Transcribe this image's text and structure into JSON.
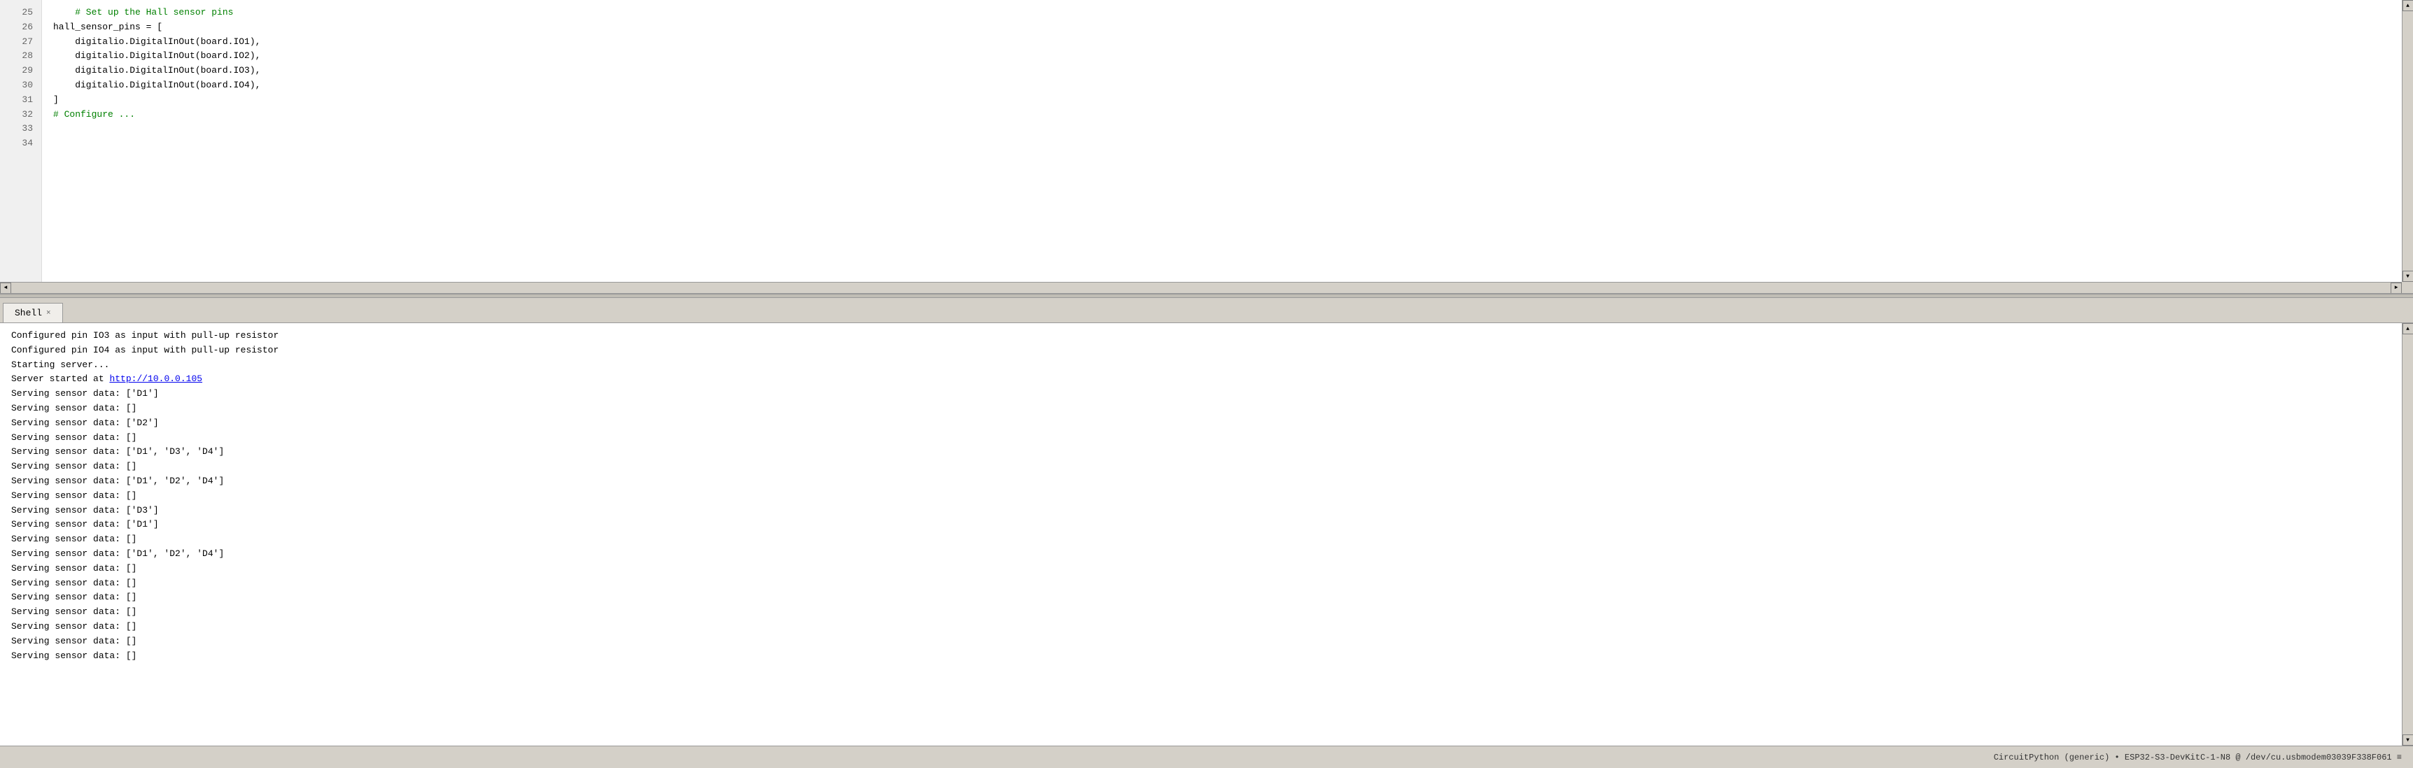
{
  "code_editor": {
    "lines": [
      {
        "num": "25",
        "content": "",
        "type": "normal"
      },
      {
        "num": "26",
        "content": "    # Set up the Hall sensor pins",
        "type": "comment"
      },
      {
        "num": "27",
        "content": "hall_sensor_pins = [",
        "type": "normal"
      },
      {
        "num": "28",
        "content": "    digitalio.DigitalInOut(board.IO1),",
        "type": "normal"
      },
      {
        "num": "29",
        "content": "    digitalio.DigitalInOut(board.IO2),",
        "type": "normal"
      },
      {
        "num": "30",
        "content": "    digitalio.DigitalInOut(board.IO3),",
        "type": "normal"
      },
      {
        "num": "31",
        "content": "    digitalio.DigitalInOut(board.IO4),",
        "type": "normal"
      },
      {
        "num": "32",
        "content": "]",
        "type": "normal"
      },
      {
        "num": "33",
        "content": "",
        "type": "normal"
      },
      {
        "num": "34",
        "content": "# Configure ...",
        "type": "comment"
      }
    ]
  },
  "shell": {
    "tab_label": "Shell",
    "tab_close": "×",
    "output_lines": [
      "Configured pin IO3 as input with pull-up resistor",
      "Configured pin IO4 as input with pull-up resistor",
      "Starting server...",
      "Server started at http://10.0.0.105",
      "Serving sensor data: ['D1']",
      "Serving sensor data: []",
      "Serving sensor data: ['D2']",
      "Serving sensor data: []",
      "Serving sensor data: ['D1', 'D3', 'D4']",
      "Serving sensor data: []",
      "Serving sensor data: ['D1', 'D2', 'D4']",
      "Serving sensor data: []",
      "Serving sensor data: ['D3']",
      "Serving sensor data: ['D1']",
      "Serving sensor data: []",
      "Serving sensor data: ['D1', 'D2', 'D4']",
      "Serving sensor data: []",
      "Serving sensor data: []",
      "Serving sensor data: []",
      "Serving sensor data: []",
      "Serving sensor data: []",
      "Serving sensor data: []",
      "Serving sensor data: []"
    ],
    "server_url": "http://10.0.0.105"
  },
  "status_bar": {
    "text": "CircuitPython (generic)  •  ESP32-S3-DevKitC-1-N8 @ /dev/cu.usbmodem03039F338F061  ≡"
  },
  "icons": {
    "up_arrow": "▲",
    "down_arrow": "▼",
    "left_arrow": "◄",
    "right_arrow": "►"
  }
}
